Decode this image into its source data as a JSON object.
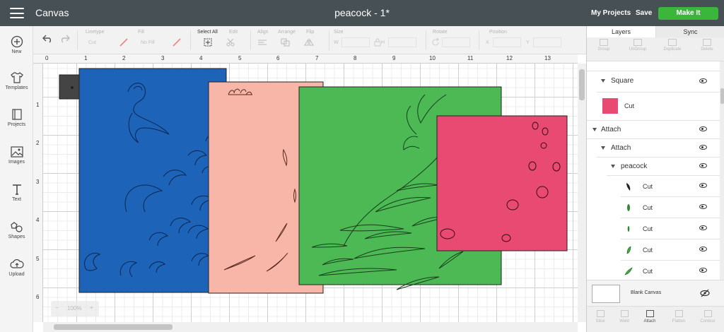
{
  "header": {
    "app_name": "Canvas",
    "project_name": "peacock - 1*",
    "my_projects": "My Projects",
    "save": "Save",
    "make_it": "Make It"
  },
  "left_nav": [
    {
      "label": "New",
      "icon": "plus-circle-icon"
    },
    {
      "label": "Templates",
      "icon": "tshirt-icon"
    },
    {
      "label": "Projects",
      "icon": "book-icon"
    },
    {
      "label": "Images",
      "icon": "image-icon"
    },
    {
      "label": "Text",
      "icon": "text-icon"
    },
    {
      "label": "Shapes",
      "icon": "shapes-icon"
    },
    {
      "label": "Upload",
      "icon": "cloud-upload-icon"
    }
  ],
  "toolbar": {
    "linetype_label": "Linetype",
    "linetype_value": "Cut",
    "fill_label": "Fill",
    "fill_value": "No Fill",
    "select_all": "Select All",
    "edit": "Edit",
    "align": "Align",
    "arrange": "Arrange",
    "flip": "Flip",
    "size": "Size",
    "size_w": "W",
    "size_h": "H",
    "rotate": "Rotate",
    "position": "Position",
    "position_x": "X",
    "position_y": "Y"
  },
  "panel": {
    "tabs": [
      "Layers",
      "Sync"
    ],
    "tools": [
      "Group",
      "UnGroup",
      "Duplicate",
      "Delete"
    ],
    "layers": [
      {
        "label": "Square",
        "level": 1,
        "arrow": true
      },
      {
        "label": "Cut",
        "level": 1,
        "swatch": "#e84a72",
        "tall": true
      },
      {
        "label": "Attach",
        "level": 0,
        "arrow": true
      },
      {
        "label": "Attach",
        "level": 1,
        "arrow": true
      },
      {
        "label": "peacock",
        "level": 2,
        "arrow": true
      },
      {
        "label": "Cut",
        "level": 3,
        "icon": "feather-dark-icon",
        "color": "#222"
      },
      {
        "label": "Cut",
        "level": 3,
        "icon": "leaf-green-icon",
        "color": "#2f8a2f"
      },
      {
        "label": "Cut",
        "level": 3,
        "icon": "leaf-green-icon",
        "color": "#2f8a2f"
      },
      {
        "label": "Cut",
        "level": 3,
        "icon": "leaf-green-icon",
        "color": "#3cb043"
      },
      {
        "label": "Cut",
        "level": 3,
        "icon": "leaf-green-icon",
        "color": "#3cb043"
      }
    ],
    "blank_canvas": "Blank Canvas",
    "bottom_tools": [
      "Slice",
      "Weld",
      "Attach",
      "Flatten",
      "Contour"
    ]
  },
  "ruler": {
    "h": [
      "0",
      "1",
      "2",
      "3",
      "4",
      "5",
      "6",
      "7",
      "8",
      "9",
      "10",
      "11",
      "12",
      "13"
    ],
    "v": [
      "1",
      "2",
      "3",
      "4",
      "5",
      "6"
    ]
  },
  "zoom": "100%",
  "colors": {
    "header": "#475055",
    "make_it": "#3ab73a",
    "blue": "#1d63b7",
    "peach": "#f8b6a8",
    "green": "#4cb955",
    "pink": "#e84a72"
  }
}
